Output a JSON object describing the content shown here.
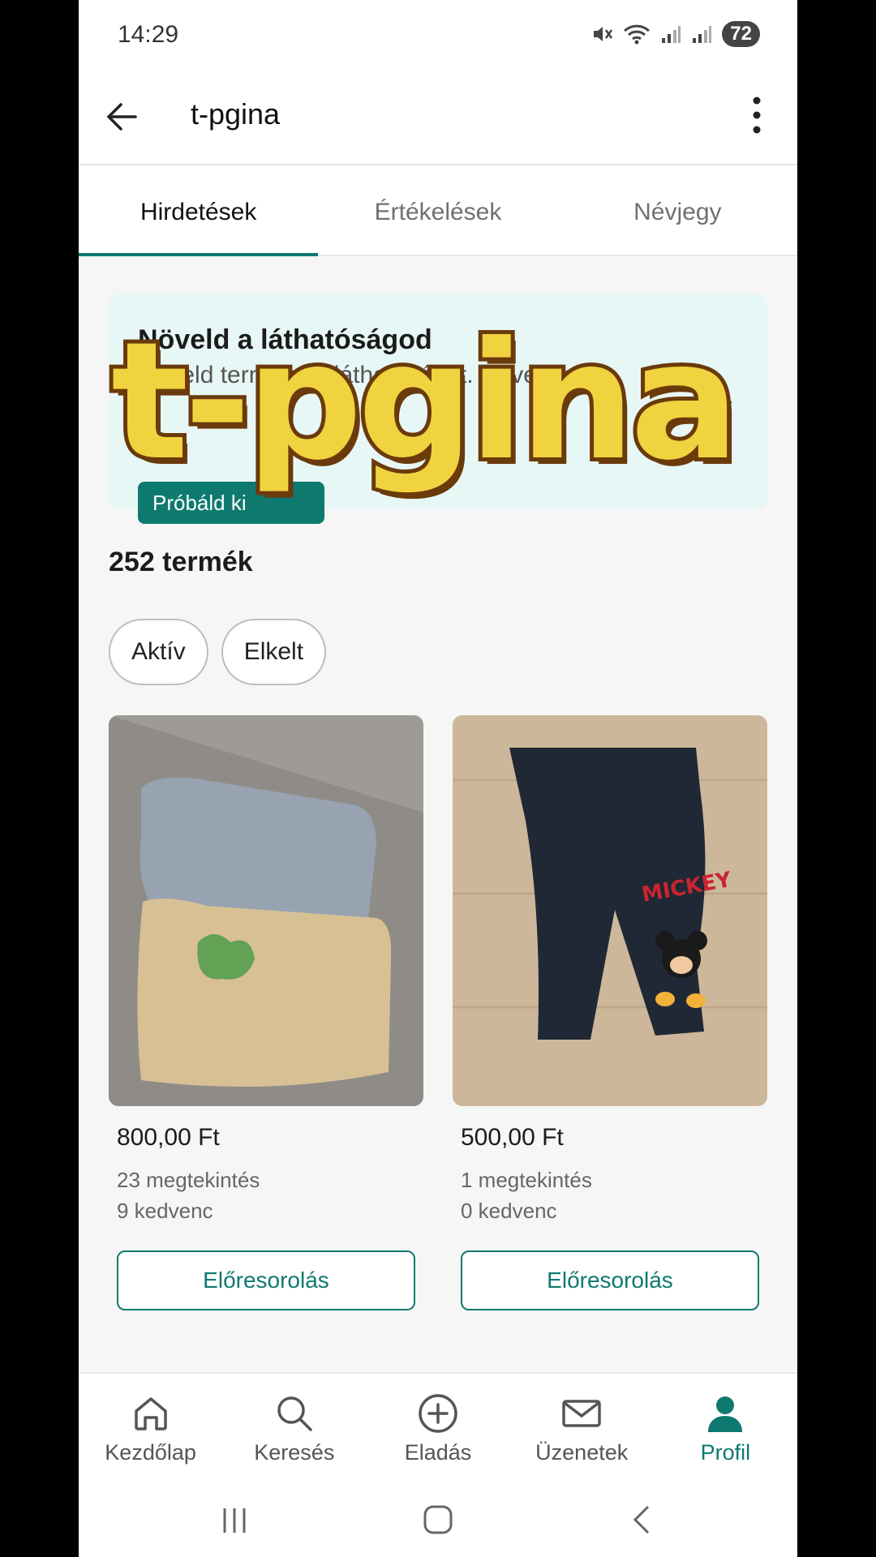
{
  "status_bar": {
    "time": "14:29",
    "battery": "72"
  },
  "app_bar": {
    "title": "t-pgina"
  },
  "tabs": [
    {
      "label": "Hirdetések",
      "active": true
    },
    {
      "label": "Értékelések",
      "active": false
    },
    {
      "label": "Névjegy",
      "active": false
    }
  ],
  "promo": {
    "title": "Növeld a láthatóságod",
    "text": "Növeld termékeid láthatóságát. Növeld az",
    "button": "Próbáld ki"
  },
  "overlay_watermark": "t-pgina",
  "products_count": "252 termék",
  "filters": [
    {
      "label": "Aktív"
    },
    {
      "label": "Elkelt"
    }
  ],
  "products": [
    {
      "price": "800,00 Ft",
      "views": "23 megtekintés",
      "favorites": "9 kedvenc",
      "button": "Előresorolás"
    },
    {
      "price": "500,00 Ft",
      "views": "1 megtekintés",
      "favorites": "0 kedvenc",
      "button": "Előresorolás"
    }
  ],
  "bottom_nav": [
    {
      "label": "Kezdőlap",
      "icon": "home-icon"
    },
    {
      "label": "Keresés",
      "icon": "search-icon"
    },
    {
      "label": "Eladás",
      "icon": "plus-circle-icon"
    },
    {
      "label": "Üzenetek",
      "icon": "mail-icon"
    },
    {
      "label": "Profil",
      "icon": "person-icon",
      "active": true
    }
  ],
  "colors": {
    "accent": "#0e7a6f",
    "promo_bg": "#e7f7f5"
  }
}
